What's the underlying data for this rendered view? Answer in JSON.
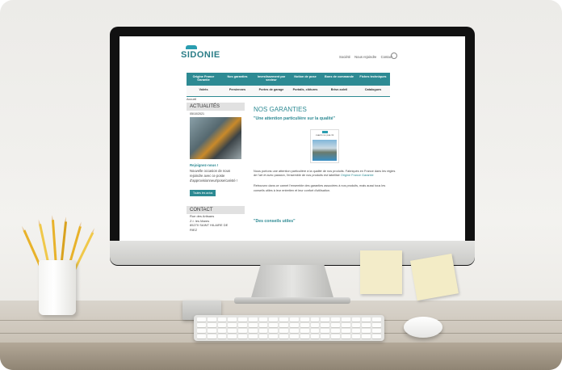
{
  "site": {
    "logo_text": "SIDONIE",
    "top_links": [
      "Société",
      "Nous rejoindre",
      "Contact"
    ],
    "accent_color": "#2d8a93"
  },
  "nav_primary": [
    "Origine France Garantie",
    "Nos garanties",
    "Investissement par secteur",
    "Notion de pose",
    "Bons de commande",
    "Fiches techniques"
  ],
  "nav_secondary": [
    "Volets",
    "Persiennes",
    "Portes de garage",
    "Portails, clôtures",
    "Brise-soleil",
    "Catalogues"
  ],
  "breadcrumb": "Accueil",
  "sidebar": {
    "news_title": "ACTUALITÉS",
    "news_date": "05/10/2021",
    "news_heading": "Rejoignez-nous !",
    "news_text": "Nouvelle occasion de nous rejoindre avec ce poste d'approvisionneur/pose/caristé !",
    "news_button": "Toutes les actus",
    "contact_title": "CONTACT",
    "contact_lines": [
      "Rue des Artisans",
      "Z.I. les Mares",
      "85270 SAINT HILAIRE DE",
      "RIEZ"
    ]
  },
  "main": {
    "title": "NOS GARANTIES",
    "quote": "\"Une attention particulière sur la qualité\"",
    "thumb_caption": "CHARTE DE QUALITÉ",
    "paragraph1_start": "Nous portons une attention particulière à la qualité de nos produits. Fabriqués en France dans les règles de l'art et avec passion, l'ensemble de nos produits est labellisé ",
    "paragraph1_link": "Origine France Garantie",
    "paragraph2": "Retrouvez dans ce carnet l'ensemble des garanties associées à nos produits, mais aussi tous les conseils utiles à leur entretien et leur confort d'utilisation.",
    "quote2": "\"Des conseils utiles\""
  }
}
